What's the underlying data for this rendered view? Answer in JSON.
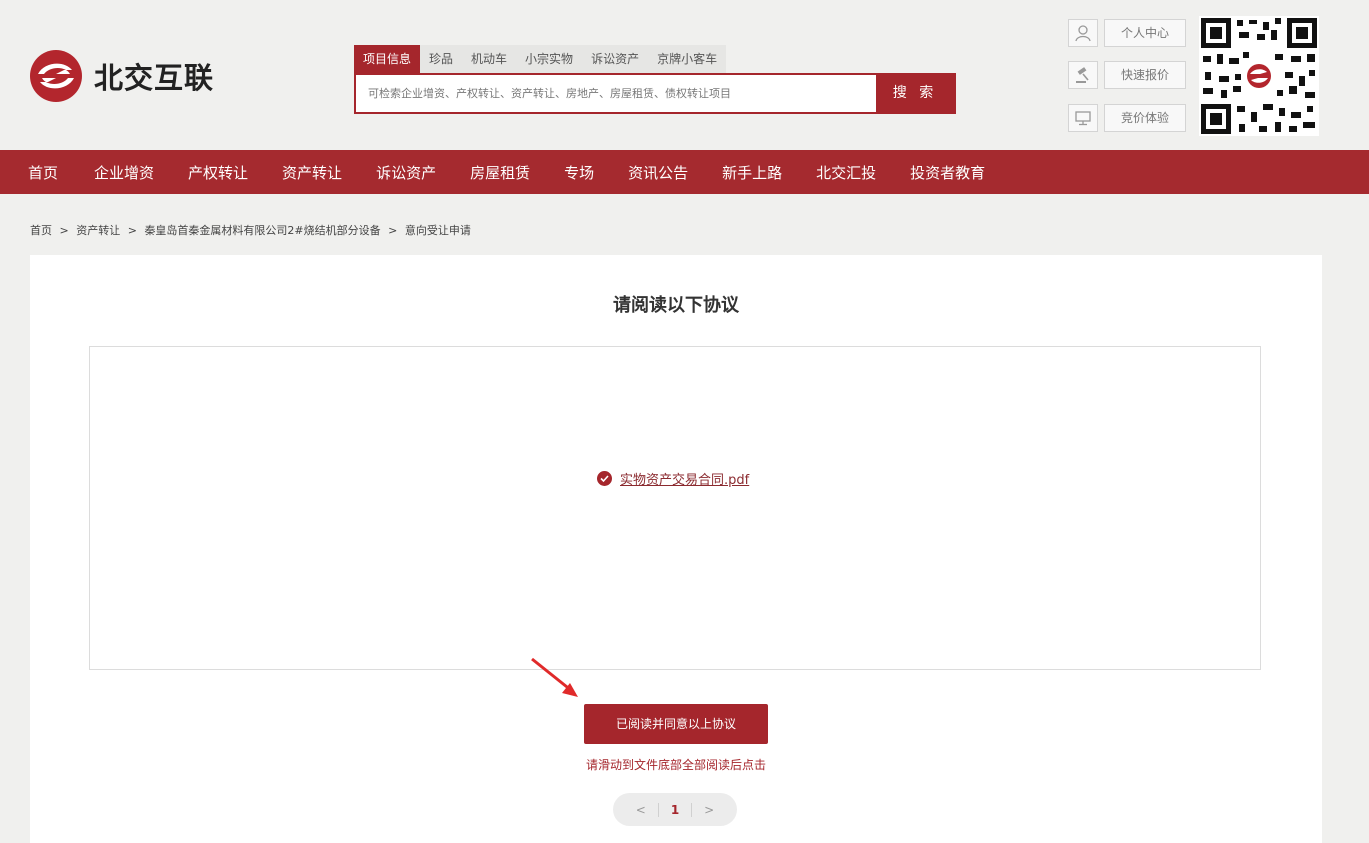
{
  "brand": {
    "name": "北交互联",
    "accent": "#a5262c"
  },
  "search": {
    "tabs": [
      "项目信息",
      "珍品",
      "机动车",
      "小宗实物",
      "诉讼资产",
      "京牌小客车"
    ],
    "active_tab": "项目信息",
    "placeholder": "可检索企业增资、产权转让、资产转让、房地产、房屋租赁、债权转让项目",
    "button": "搜 索"
  },
  "quick_links": [
    {
      "icon": "user-icon",
      "label": "个人中心"
    },
    {
      "icon": "gavel-icon",
      "label": "快速报价"
    },
    {
      "icon": "monitor-icon",
      "label": "竞价体验"
    }
  ],
  "nav": [
    "首页",
    "企业增资",
    "产权转让",
    "资产转让",
    "诉讼资产",
    "房屋租赁",
    "专场",
    "资讯公告",
    "新手上路",
    "北交汇投",
    "投资者教育"
  ],
  "breadcrumb": [
    "首页",
    ">",
    "资产转让",
    ">",
    "秦皇岛首秦金属材料有限公司2#烧结机部分设备",
    ">",
    "意向受让申请"
  ],
  "agreement": {
    "title": "请阅读以下协议",
    "file_name": "实物资产交易合同.pdf",
    "agree_button": "已阅读并同意以上协议",
    "hint": "请滑动到文件底部全部阅读后点击"
  },
  "pager": {
    "prev": "<",
    "current": "1",
    "next": ">"
  }
}
